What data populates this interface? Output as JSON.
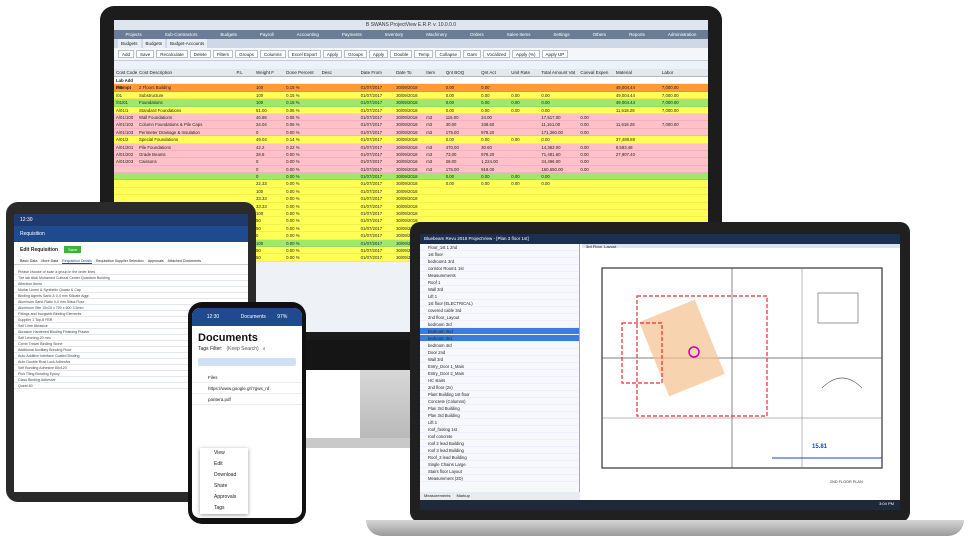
{
  "desktop": {
    "title": "B SWANS ProjectView E.R.P. v. 10.0.0.0",
    "menu": [
      "Projects",
      "Sub-Contractors",
      "Budgets",
      "Payroll",
      "Accounting",
      "Payments",
      "Inventory",
      "Machinery",
      "Orders",
      "Sales-Items",
      "Settings",
      "Others",
      "Reports",
      "Administration"
    ],
    "tabs": [
      "Budgets",
      "Budgets",
      "Budget-Accounts"
    ],
    "toolbar": [
      "Add",
      "Save",
      "Recalculate",
      "Delete",
      "Filters",
      "Groups",
      "Columns",
      "Excel Export",
      "Apply",
      "Groups",
      "Apply",
      "Double",
      "Temp",
      "Collapse",
      "Gant",
      "Vocalized",
      "Apply (%)",
      "Apply UP"
    ],
    "columns": [
      "Cost Code",
      "Cost Description",
      "P.L",
      "Weight F",
      "Done Percent",
      "Desc",
      "",
      "Date From",
      "Date To",
      "Item",
      "Qnt BOQ",
      "Qnt Act",
      "Unit Rate",
      "Total Amount Vat",
      "Coeval Expen",
      "Material",
      "Labor"
    ],
    "group": "Lab Add Prompt",
    "rows": [
      {
        "code": "/2B",
        "desc": "2 Floors Building",
        "wt": "100",
        "pct": "0.15 %",
        "df": "01/07/2017",
        "dt": "30/09/2018",
        "unit": "",
        "qb": "0.00",
        "qa": "0.00",
        "rate": "",
        "tot": "",
        "exp": "",
        "mat": "49,004.44",
        "lab": "7,000.00",
        "c": "#ff9a35"
      },
      {
        "code": "/01",
        "desc": "Substructure",
        "wt": "100",
        "pct": "0.15 %",
        "df": "01/07/2017",
        "dt": "30/09/2018",
        "unit": "",
        "qb": "0.00",
        "qa": "0.00",
        "rate": "0.00",
        "tot": "0.00",
        "exp": "",
        "mat": "49,004.44",
        "lab": "7,000.00",
        "c": "#ffff55"
      },
      {
        "code": "/01/01",
        "desc": "Foundations",
        "wt": "100",
        "pct": "0.15 %",
        "df": "01/07/2017",
        "dt": "30/09/2018",
        "unit": "",
        "qb": "0.00",
        "qa": "0.00",
        "rate": "0.00",
        "tot": "0.00",
        "exp": "",
        "mat": "49,004.44",
        "lab": "7,000.00",
        "c": "#9ee86a"
      },
      {
        "code": "A/01/1",
        "desc": "Standard Foundations",
        "wt": "51.00",
        "pct": "0.06 %",
        "df": "01/07/2017",
        "dt": "30/09/2018",
        "unit": "",
        "qb": "0.00",
        "qa": "0.00",
        "rate": "0.00",
        "tot": "0.00",
        "exp": "",
        "mat": "11,618.28",
        "lab": "7,000.00",
        "c": "#ffff55"
      },
      {
        "code": "A/01/100",
        "desc": "Wall Foundations",
        "wt": "46.86",
        "pct": "0.06 %",
        "df": "01/07/2017",
        "dt": "30/09/2018",
        "unit": "m3",
        "qb": "115.00",
        "qa": "24.00",
        "rate": "",
        "tot": "17,517.00",
        "exp": "0.00",
        "mat": "",
        "lab": "",
        "c": "#ffc0c8"
      },
      {
        "code": "A/01/102",
        "desc": "Column Foundations & Pile Caps",
        "wt": "34.04",
        "pct": "0.06 %",
        "df": "01/07/2017",
        "dt": "30/09/2018",
        "unit": "m3",
        "qb": "30.00",
        "qa": "338.60",
        "rate": "",
        "tot": "11,161.00",
        "exp": "0.00",
        "mat": "11,618.28",
        "lab": "7,000.00",
        "c": "#ffc0c8"
      },
      {
        "code": "A/01/103",
        "desc": "Perimeter Drainage & Insulation",
        "wt": "0",
        "pct": "0.00 %",
        "df": "01/07/2017",
        "dt": "30/09/2018",
        "unit": "m3",
        "qb": "175.00",
        "qa": "979.20",
        "rate": "",
        "tot": "171,360.00",
        "exp": "0.00",
        "mat": "",
        "lab": "",
        "c": "#ffc0c8"
      },
      {
        "code": "A/01/2",
        "desc": "Special Foundations",
        "wt": "49.04",
        "pct": "0.14 %",
        "df": "01/07/2017",
        "dt": "30/09/2018",
        "unit": "",
        "qb": "0.00",
        "qa": "0.00",
        "rate": "0.00",
        "tot": "0.00",
        "exp": "",
        "mat": "37,488.88",
        "lab": "",
        "c": "#ffff55"
      },
      {
        "code": "A/01/201",
        "desc": "Pile Foundations",
        "wt": "42.2",
        "pct": "0.22 %",
        "df": "01/07/2017",
        "dt": "30/09/2018",
        "unit": "m3",
        "qb": "470.00",
        "qa": "30.60",
        "rate": "",
        "tot": "14,382.00",
        "exp": "0.00",
        "mat": "8,583.48",
        "lab": "",
        "c": "#ffc0c8"
      },
      {
        "code": "A/01/202",
        "desc": "Grade Beams",
        "wt": "28.8",
        "pct": "0.00 %",
        "df": "01/07/2017",
        "dt": "30/09/2018",
        "unit": "m3",
        "qb": "73.00",
        "qa": "979.20",
        "rate": "",
        "tot": "71,481.60",
        "exp": "0.00",
        "mat": "27,907.40",
        "lab": "",
        "c": "#ffc0c8"
      },
      {
        "code": "A/01/203",
        "desc": "Caissons",
        "wt": "0",
        "pct": "0.00 %",
        "df": "01/07/2017",
        "dt": "30/09/2018",
        "unit": "m3",
        "qb": "28.00",
        "qa": "1,224.00",
        "rate": "",
        "tot": "34,496.00",
        "exp": "0.00",
        "mat": "",
        "lab": "",
        "c": "#ffc0c8"
      },
      {
        "code": "",
        "desc": "",
        "wt": "0",
        "pct": "0.00 %",
        "df": "01/07/2017",
        "dt": "30/09/2018",
        "unit": "m3",
        "qb": "175.00",
        "qa": "918.00",
        "rate": "",
        "tot": "160,650.00",
        "exp": "0.00",
        "mat": "",
        "lab": "",
        "c": "#ffc0c8"
      },
      {
        "code": "",
        "desc": "",
        "wt": "0",
        "pct": "0.00 %",
        "df": "01/07/2017",
        "dt": "30/09/2018",
        "unit": "",
        "qb": "0.00",
        "qa": "0.00",
        "rate": "0.00",
        "tot": "0.00",
        "exp": "",
        "mat": "",
        "lab": "",
        "c": "#9ee86a"
      },
      {
        "code": "",
        "desc": "",
        "wt": "22.33",
        "pct": "0.00 %",
        "df": "01/07/2017",
        "dt": "30/09/2018",
        "unit": "",
        "qb": "0.00",
        "qa": "0.00",
        "rate": "0.00",
        "tot": "0.00",
        "exp": "",
        "mat": "",
        "lab": "",
        "c": "#ffff55"
      },
      {
        "code": "",
        "desc": "",
        "wt": "100",
        "pct": "0.00 %",
        "df": "01/07/2017",
        "dt": "30/09/2018",
        "unit": "",
        "qb": "",
        "qa": "",
        "rate": "",
        "tot": "",
        "exp": "",
        "mat": "",
        "lab": "",
        "c": "#ffff55"
      },
      {
        "code": "",
        "desc": "",
        "wt": "33.33",
        "pct": "0.00 %",
        "df": "01/07/2017",
        "dt": "30/09/2018",
        "unit": "",
        "qb": "",
        "qa": "",
        "rate": "",
        "tot": "",
        "exp": "",
        "mat": "",
        "lab": "",
        "c": "#ffff55"
      },
      {
        "code": "",
        "desc": "",
        "wt": "33.33",
        "pct": "0.00 %",
        "df": "01/07/2017",
        "dt": "30/09/2018",
        "unit": "",
        "qb": "",
        "qa": "",
        "rate": "",
        "tot": "",
        "exp": "",
        "mat": "",
        "lab": "",
        "c": "#ffff55"
      },
      {
        "code": "",
        "desc": "",
        "wt": "100",
        "pct": "0.00 %",
        "df": "01/07/2017",
        "dt": "30/09/2018",
        "unit": "",
        "qb": "",
        "qa": "",
        "rate": "",
        "tot": "",
        "exp": "",
        "mat": "",
        "lab": "",
        "c": "#ffff55"
      },
      {
        "code": "",
        "desc": "",
        "wt": "50",
        "pct": "0.00 %",
        "df": "01/07/2017",
        "dt": "30/09/2018",
        "unit": "",
        "qb": "",
        "qa": "",
        "rate": "",
        "tot": "",
        "exp": "",
        "mat": "",
        "lab": "",
        "c": "#ffff55"
      },
      {
        "code": "",
        "desc": "",
        "wt": "50",
        "pct": "0.00 %",
        "df": "01/07/2017",
        "dt": "30/09/2018",
        "unit": "",
        "qb": "",
        "qa": "",
        "rate": "",
        "tot": "",
        "exp": "",
        "mat": "",
        "lab": "",
        "c": "#ffff55"
      },
      {
        "code": "",
        "desc": "",
        "wt": "0",
        "pct": "0.00 %",
        "df": "01/07/2017",
        "dt": "30/09/2018",
        "unit": "",
        "qb": "",
        "qa": "",
        "rate": "",
        "tot": "",
        "exp": "",
        "mat": "",
        "lab": "",
        "c": "#ffff55"
      },
      {
        "code": "",
        "desc": "",
        "wt": "100",
        "pct": "0.00 %",
        "df": "01/07/2017",
        "dt": "30/09/2018",
        "unit": "",
        "qb": "",
        "qa": "",
        "rate": "",
        "tot": "",
        "exp": "",
        "mat": "",
        "lab": "",
        "c": "#9ee86a"
      },
      {
        "code": "",
        "desc": "",
        "wt": "50",
        "pct": "0.00 %",
        "df": "01/07/2017",
        "dt": "30/09/2018",
        "unit": "",
        "qb": "",
        "qa": "",
        "rate": "",
        "tot": "",
        "exp": "",
        "mat": "",
        "lab": "",
        "c": "#ffff55"
      },
      {
        "code": "",
        "desc": "",
        "wt": "50",
        "pct": "0.00 %",
        "df": "01/07/2017",
        "dt": "30/09/2018",
        "unit": "",
        "qb": "",
        "qa": "",
        "rate": "",
        "tot": "",
        "exp": "",
        "mat": "",
        "lab": "",
        "c": "#ffff55"
      }
    ]
  },
  "laptop": {
    "title": "Bluebeam Revu 2018 ProjectView - [Plan 3 floor 1st]",
    "tab": "3rd Floor_Layout",
    "tree": [
      "Floor_1st 1 2nd",
      "1st floor",
      "bedroom1 3rd",
      "corridor Room1 1st",
      "Measurements",
      "Roof 1",
      "Wall 3rd",
      "Lift 1",
      "1st floor (ELECTRICAL)",
      "covered cable 3rd",
      "2nd floor_Layout",
      "bedroom 3rd",
      "bedroom 2nd",
      "bedroom 3rd",
      "bedroom 4rd",
      "Door 2nd",
      "Wall 3rd",
      "Entry_Door 1_Main",
      "Entry_Door 2_Main",
      "HC stairs",
      "2nd floor (2x)",
      "Plant Building 1st floor",
      "Concrete (Columns)",
      "Plan 3rd Building",
      "Plan 3rd Building",
      "Lift 1",
      "roof_footing 1st",
      "roof concrete",
      "roof 2 lead Building",
      "roof 3 lead Building",
      "Roof_3 lead Building",
      "Single Chains Large",
      "Stairs floor Layout",
      "Measurement (2D)"
    ],
    "dimension": "15.81",
    "plan_label": "2ND FLOOR PLAN",
    "status": [
      "Measurements",
      "Markup"
    ],
    "clock": "3:04 PM"
  },
  "tablet": {
    "time": "12:30",
    "header": "Requisition",
    "subheader": "Edit Requisition",
    "tabs": [
      "Basic Data",
      "More Data",
      "Requisition Details",
      "Requisition Supplier Selection",
      "Approvals",
      "Attached Documents"
    ],
    "lines": [
      "Please choose or scan a group in the order lines",
      "The lab Abdi Mohamed Cultural Center Quantum Building",
      "Attention Items",
      "Mortar Limes & Synthetic Quartz & Cap",
      "Binding Agents Sand & 0.4 mm Silicate Aggr.",
      "Aluminum Sand Ratio 0.4 mm Silica Flour",
      "Aluminum Site 10x20 x 700 x 600 3.5mm",
      "Fittings and Inorganic Binding Elements",
      "Supplier 1 Top-8 FBR",
      "Self Lime Abrasive",
      "Abrasive Hardened Binding Finishing Plaster",
      "Self Leveling 20 mm",
      "Comb Trowel Binding Stone",
      "Additional Auxiliary Bonding Floor",
      "Auto Additive Interface Coated Binding",
      "Auto Double Rust Lock Adhesive",
      "Self Bonding Adhesive 60x120",
      "Plus Tiling Bonding Epoxy",
      "Class Binding Adhesive",
      "Quest 60"
    ],
    "button": "Save"
  },
  "phone": {
    "time": "12:30",
    "status": "97%",
    "header": "Documents",
    "title": "Documents",
    "tags_label": "Tags Filter:",
    "tags_value": "(Keep Search)",
    "files": [
      "Files",
      "https://www.google.gr/?gws_rd",
      "pantera.pdf"
    ],
    "menu": [
      "View",
      "Edit",
      "Download",
      "Share",
      "Approvals",
      "Tags"
    ]
  }
}
